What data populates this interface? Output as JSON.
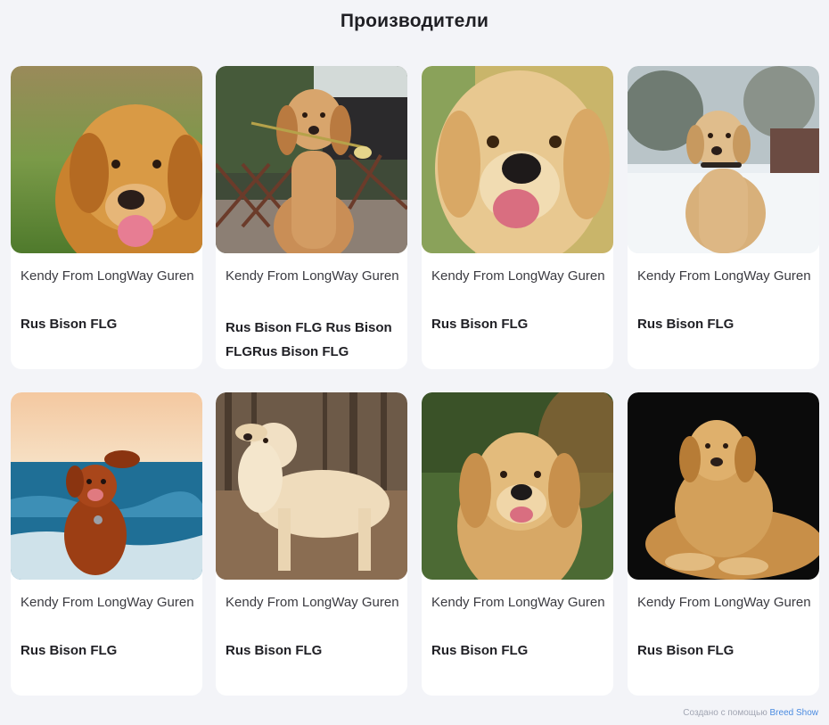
{
  "page": {
    "title": "Производители"
  },
  "cards": [
    {
      "kennel": "Kendy From LongWay Guren",
      "name": "Rus Bison FLG",
      "photo": "golden-retriever-field-photo"
    },
    {
      "kennel": "Kendy From LongWay Guren",
      "name": "Rus Bison FLG Rus Bison FLGRus Bison FLG",
      "photo": "retriever-with-rose-photo"
    },
    {
      "kennel": "Kendy From LongWay Guren",
      "name": "Rus Bison FLG",
      "photo": "golden-retriever-closeup-photo"
    },
    {
      "kennel": "Kendy From LongWay Guren",
      "name": "Rus Bison FLG",
      "photo": "labrador-snow-photo"
    },
    {
      "kennel": "Kendy From LongWay Guren",
      "name": "Rus Bison FLG",
      "photo": "dog-at-sea-photo"
    },
    {
      "kennel": "Kendy From LongWay Guren",
      "name": "Rus Bison FLG",
      "photo": "golden-retriever-forest-photo"
    },
    {
      "kennel": "Kendy From LongWay Guren",
      "name": "Rus Bison FLG",
      "photo": "golden-retriever-smiling-photo"
    },
    {
      "kennel": "Kendy From LongWay Guren",
      "name": "Rus Bison FLG",
      "photo": "golden-retriever-black-bg-photo"
    }
  ],
  "footer": {
    "prefix": "Создано с помощью",
    "link": "Breed Show"
  }
}
